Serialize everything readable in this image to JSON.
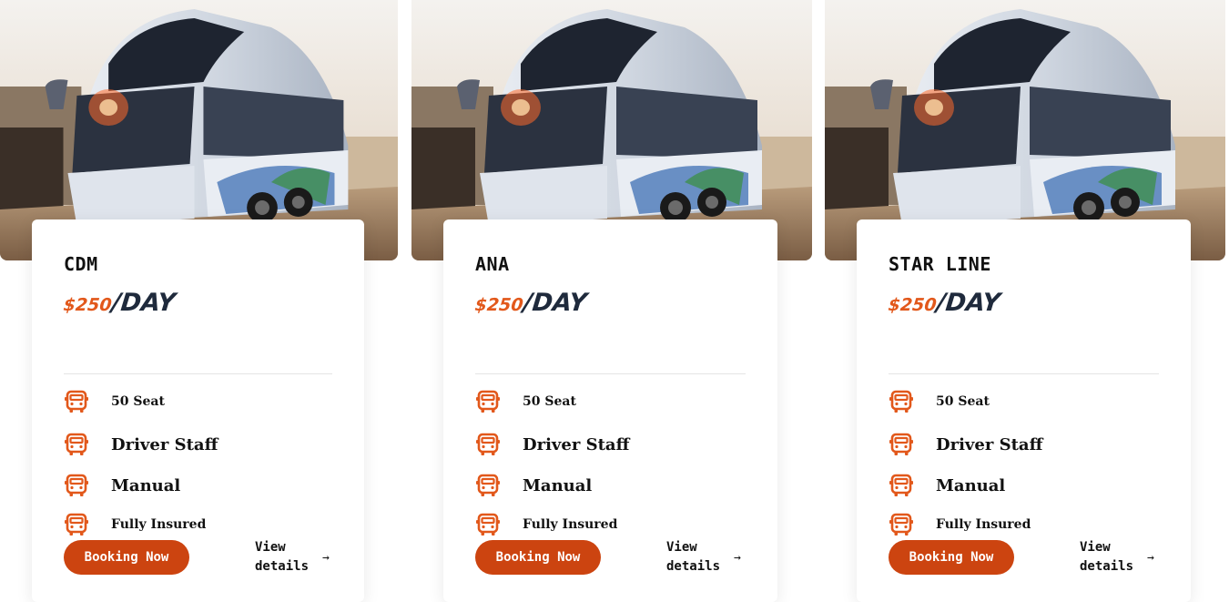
{
  "theme": {
    "accent": "#e2581b",
    "button": "#cc4410",
    "price_unit": "#1f2a3c"
  },
  "cards": [
    {
      "name": "CDM",
      "price_amount": "$250",
      "price_unit": "/DAY",
      "features": [
        {
          "icon": "bus-icon",
          "label": "50 Seat"
        },
        {
          "icon": "bus-icon",
          "label": "Driver Staff"
        },
        {
          "icon": "bus-icon",
          "label": "Manual"
        },
        {
          "icon": "bus-icon",
          "label": "Fully Insured"
        }
      ],
      "booking_label": "Booking Now",
      "view_label": "View details",
      "view_arrow": "→"
    },
    {
      "name": "ANA",
      "price_amount": "$250",
      "price_unit": "/DAY",
      "features": [
        {
          "icon": "bus-icon",
          "label": "50 Seat"
        },
        {
          "icon": "bus-icon",
          "label": "Driver Staff"
        },
        {
          "icon": "bus-icon",
          "label": "Manual"
        },
        {
          "icon": "bus-icon",
          "label": "Fully Insured"
        }
      ],
      "booking_label": "Booking Now",
      "view_label": "View details",
      "view_arrow": "→"
    },
    {
      "name": "STAR LINE",
      "price_amount": "$250",
      "price_unit": "/DAY",
      "features": [
        {
          "icon": "bus-icon",
          "label": "50 Seat"
        },
        {
          "icon": "bus-icon",
          "label": "Driver Staff"
        },
        {
          "icon": "bus-icon",
          "label": "Manual"
        },
        {
          "icon": "bus-icon",
          "label": "Fully Insured"
        }
      ],
      "booking_label": "Booking Now",
      "view_label": "View details",
      "view_arrow": "→"
    }
  ]
}
